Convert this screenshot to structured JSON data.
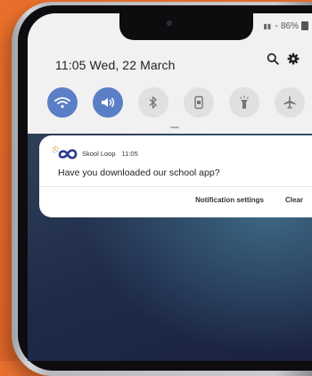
{
  "status_bar": {
    "battery": "86%"
  },
  "panel": {
    "time": "11:05",
    "date": "Wed, 22 March"
  },
  "quick_settings": [
    {
      "name": "wifi",
      "state": "on"
    },
    {
      "name": "sound",
      "state": "on"
    },
    {
      "name": "bluetooth",
      "state": "off"
    },
    {
      "name": "rotation-lock",
      "state": "off"
    },
    {
      "name": "flashlight",
      "state": "off"
    },
    {
      "name": "airplane-mode",
      "state": "off"
    }
  ],
  "notification": {
    "app_name": "Skool Loop",
    "time": "11:05",
    "message": "Have you downloaded our school app?",
    "actions": {
      "settings": "Notification settings",
      "clear": "Clear"
    }
  },
  "colors": {
    "accent": "#5b7fc7",
    "background": "#e8702e"
  }
}
